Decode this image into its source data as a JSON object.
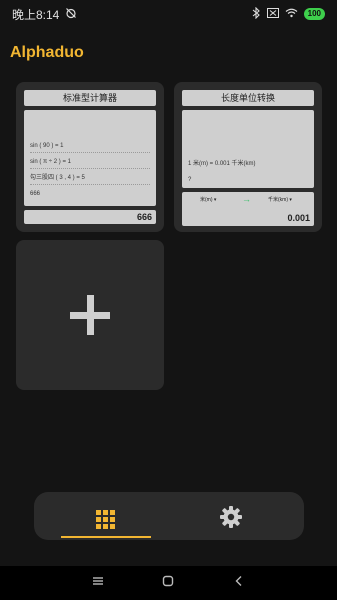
{
  "status_bar": {
    "time": "晚上8:14",
    "battery": "100",
    "icons": [
      "alarm-off-icon",
      "bluetooth-icon",
      "sim-off-icon",
      "wifi-icon",
      "battery-icon"
    ]
  },
  "app": {
    "title": "Alphaduo"
  },
  "calculator_card": {
    "title": "标准型计算器",
    "lines": [
      "sin ( 90 ) = 1",
      "sin ( π ÷ 2 ) = 1",
      "勾三股四 ( 3 , 4 ) = 5",
      "666"
    ],
    "result": "666"
  },
  "converter_card": {
    "title": "长度单位转换",
    "lines": [
      "1 米(m)  =  0.001 千米(km)",
      "?"
    ],
    "from_unit": "米(m)",
    "to_unit": "千米(km)",
    "value": "0.001"
  },
  "add_card": {
    "icon": "plus-icon"
  },
  "bottom_nav": {
    "tabs": [
      {
        "icon": "grid-icon",
        "active": true
      },
      {
        "icon": "gear-icon",
        "active": false
      }
    ],
    "accent": "#f2b632"
  },
  "system_nav": {
    "icons": [
      "menu-icon",
      "home-icon",
      "back-icon"
    ]
  }
}
